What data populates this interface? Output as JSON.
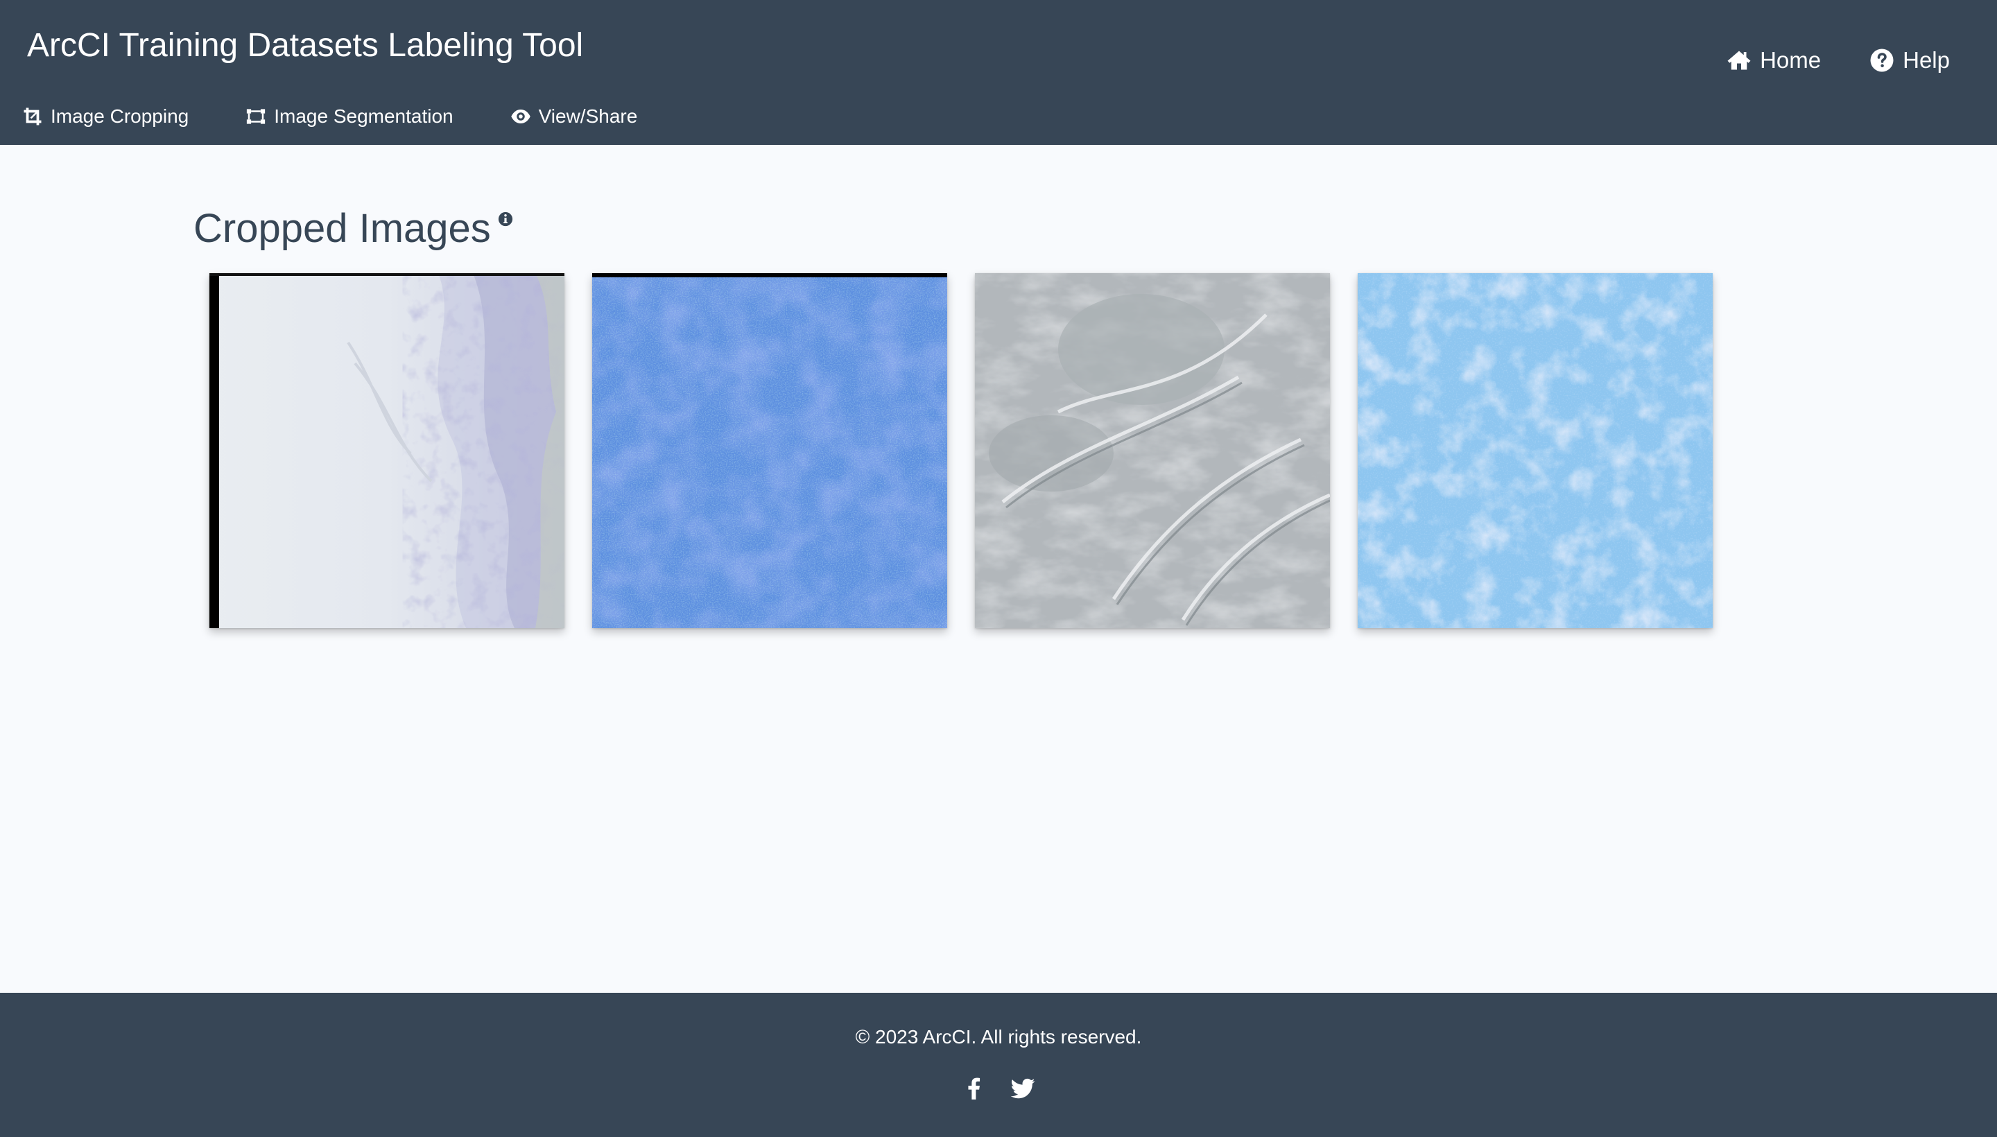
{
  "header": {
    "title": "ArcCI Training Datasets Labeling Tool",
    "top_links": [
      {
        "label": "Home",
        "icon": "home-icon"
      },
      {
        "label": "Help",
        "icon": "question-circle-icon"
      }
    ],
    "sub_nav": [
      {
        "label": "Image Cropping",
        "icon": "crop-icon"
      },
      {
        "label": "Image Segmentation",
        "icon": "segmentation-icon"
      },
      {
        "label": "View/Share",
        "icon": "eye-icon"
      }
    ]
  },
  "main": {
    "section_title": "Cropped Images",
    "info_icon": "info-circle-icon",
    "images": [
      {
        "description": "white sea ice with textured edge on right, black border on left"
      },
      {
        "description": "blue noisy water texture"
      },
      {
        "description": "grey ice with ridges"
      },
      {
        "description": "light blue mottled ice texture"
      }
    ]
  },
  "footer": {
    "copyright": "© 2023 ArcCI. All rights reserved.",
    "social": [
      {
        "icon": "facebook-icon"
      },
      {
        "icon": "twitter-icon"
      }
    ]
  },
  "colors": {
    "nav_bg": "#374656",
    "page_bg": "#f8fafd",
    "text_dark": "#374656",
    "text_light": "#ffffff"
  }
}
